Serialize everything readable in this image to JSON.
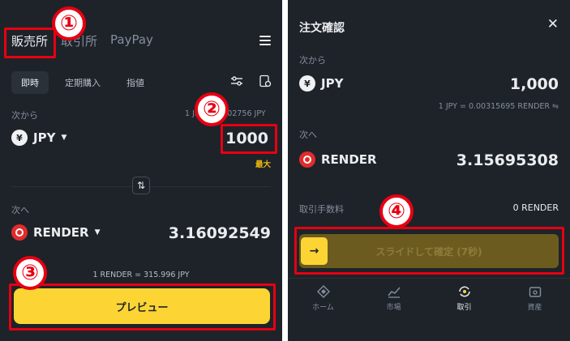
{
  "left": {
    "top_tabs": [
      "販売所",
      "取引所",
      "PayPay"
    ],
    "sub_tabs": [
      "即時",
      "定期購入",
      "指値"
    ],
    "from_label": "次から",
    "rate_text": "1 JPY = 0.002756 JPY",
    "from_currency": "JPY",
    "from_amount": "1000",
    "max_label": "最大",
    "to_label": "次へ",
    "to_currency": "RENDER",
    "to_amount": "3.16092549",
    "conversion": "1 RENDER = 315.996 JPY",
    "preview_label": "プレビュー"
  },
  "right": {
    "title": "注文確認",
    "from_label": "次から",
    "from_currency": "JPY",
    "from_amount": "1,000",
    "rate": "1 JPY = 0.00315695 RENDER",
    "to_label": "次へ",
    "to_currency": "RENDER",
    "to_amount": "3.15695308",
    "fee_label": "取引手数料",
    "fee_value": "0 RENDER",
    "slide_label": "スライドして確定 (7秒)",
    "nav": [
      "ホーム",
      "市場",
      "取引",
      "資産"
    ]
  },
  "badges": [
    "①",
    "②",
    "③",
    "④"
  ],
  "colors": {
    "background": "#1e2329",
    "accent": "#fcd535",
    "highlight": "#e60012"
  }
}
